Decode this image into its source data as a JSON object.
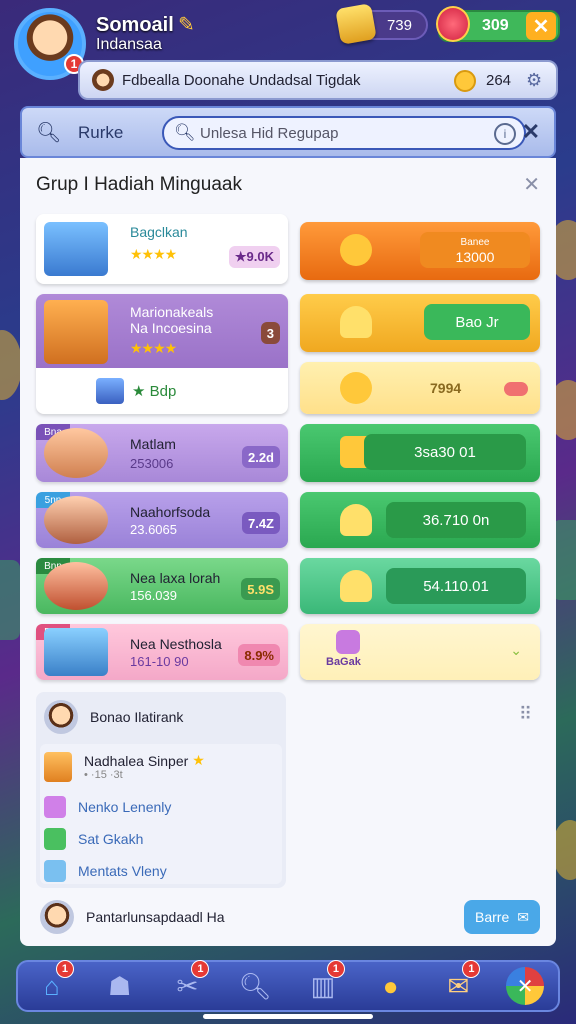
{
  "profile": {
    "name": "Somoail",
    "subtitle": "Indansaa",
    "notif": "1"
  },
  "currency": {
    "coins": "739",
    "gems": "309"
  },
  "ticker": {
    "text": "Fdbealla Doonahe Undadsal Tigdak",
    "value": "264"
  },
  "search": {
    "label": "Rurke",
    "placeholder": "Unlesa Hid Regupap"
  },
  "panel": {
    "title": "Grup I Hadiah Minguaak"
  },
  "left_cards": [
    {
      "title": "Bagclkan",
      "badge": "★9.0K"
    },
    {
      "title": "Marionakeals",
      "title2": "Na Incoesina",
      "badge": "3",
      "reward": "Bdp"
    },
    {
      "tag": "Bna",
      "title": "Matlam",
      "sub": "253006",
      "badge": "2.2d"
    },
    {
      "tag": "5nn",
      "title": "Naahorfsoda",
      "sub": "23.6065",
      "badge": "7.4Z"
    },
    {
      "tag": "Bnn",
      "title": "Nea laxa lorah",
      "sub": "156.039",
      "badge": "5.9S"
    },
    {
      "tag": "Bnn",
      "title": "Nea Nesthosla",
      "sub": "161-10 90",
      "badge": "8.9%"
    }
  ],
  "right_cards": [
    {
      "value": "13000",
      "sub": "Banee"
    },
    {
      "value": "Bao Jr"
    },
    {
      "value": "7994"
    },
    {
      "value": "3sa30 01"
    },
    {
      "value": "36.710 0n"
    },
    {
      "value": "54.110.01"
    },
    {
      "value": "BaGak"
    }
  ],
  "bottom": {
    "name": "Bonao Ilatirank",
    "item_title": "Nadhalea Sinper",
    "item_sub": "• ·15 ·3t",
    "rows": [
      "Nenko Lenenly",
      "Sat Gkakh",
      "Mentats Vleny"
    ]
  },
  "footer": {
    "text": "Pantarlunsapdaadl Ha",
    "button": "Barre"
  },
  "nav": {
    "badge1": "1",
    "badge2": "1",
    "badge3": "1",
    "badge4": "1"
  }
}
